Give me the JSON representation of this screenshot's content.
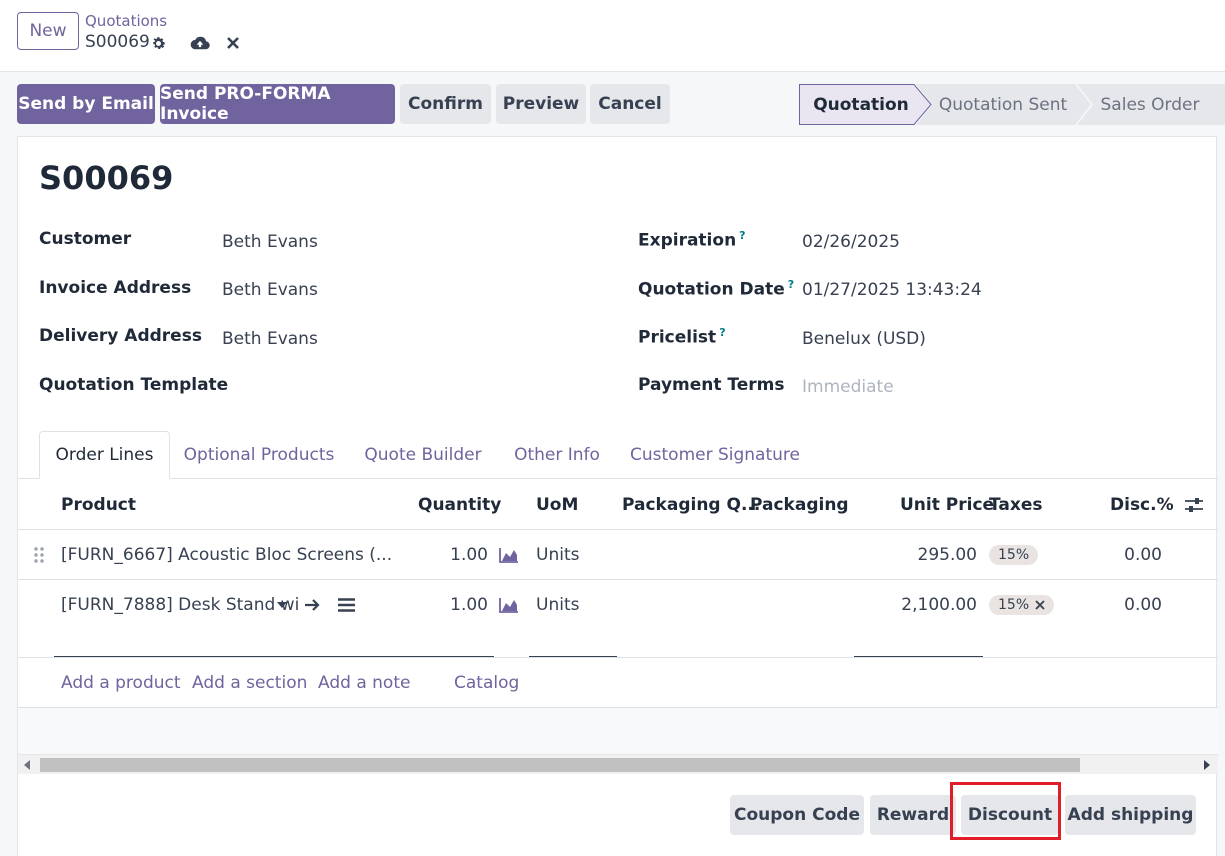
{
  "header": {
    "new_label": "New",
    "breadcrumb_parent": "Quotations",
    "breadcrumb_current": "S00069"
  },
  "actions": {
    "send_email": "Send by Email",
    "send_proforma": "Send PRO-FORMA Invoice",
    "confirm": "Confirm",
    "preview": "Preview",
    "cancel": "Cancel"
  },
  "status_stages": [
    "Quotation",
    "Quotation Sent",
    "Sales Order"
  ],
  "active_stage": "Quotation",
  "record": {
    "title": "S00069",
    "left_fields": [
      {
        "label": "Customer",
        "value": "Beth Evans"
      },
      {
        "label": "Invoice Address",
        "value": "Beth Evans"
      },
      {
        "label": "Delivery Address",
        "value": "Beth Evans"
      },
      {
        "label": "Quotation Template",
        "value": ""
      }
    ],
    "right_fields": [
      {
        "label": "Expiration",
        "help": "?",
        "value": "02/26/2025"
      },
      {
        "label": "Quotation Date",
        "help": "?",
        "value": "01/27/2025 13:43:24"
      },
      {
        "label": "Pricelist",
        "help": "?",
        "value": "Benelux (USD)"
      },
      {
        "label": "Payment Terms",
        "value": "Immediate"
      }
    ]
  },
  "tabs": [
    "Order Lines",
    "Optional Products",
    "Quote Builder",
    "Other Info",
    "Customer Signature"
  ],
  "table": {
    "columns": [
      "Product",
      "Quantity",
      "UoM",
      "Packaging Q...",
      "Packaging",
      "Unit Price",
      "Taxes",
      "Disc.%"
    ],
    "rows": [
      {
        "product": "[FURN_6667] Acoustic Bloc Screens (...",
        "quantity": "1.00",
        "uom": "Units",
        "unit_price": "295.00",
        "tax": "15%",
        "disc": "0.00"
      },
      {
        "product": "[FURN_7888] Desk Stand wi",
        "quantity": "1.00",
        "uom": "Units",
        "unit_price": "2,100.00",
        "tax": "15%",
        "disc": "0.00"
      }
    ],
    "add_links": [
      "Add a product",
      "Add a section",
      "Add a note",
      "Catalog"
    ]
  },
  "bottom_buttons": [
    "Coupon Code",
    "Reward",
    "Discount",
    "Add shipping"
  ],
  "colors": {
    "primary": "#71639e",
    "highlight": "#e11d2a",
    "help": "#017e84"
  }
}
